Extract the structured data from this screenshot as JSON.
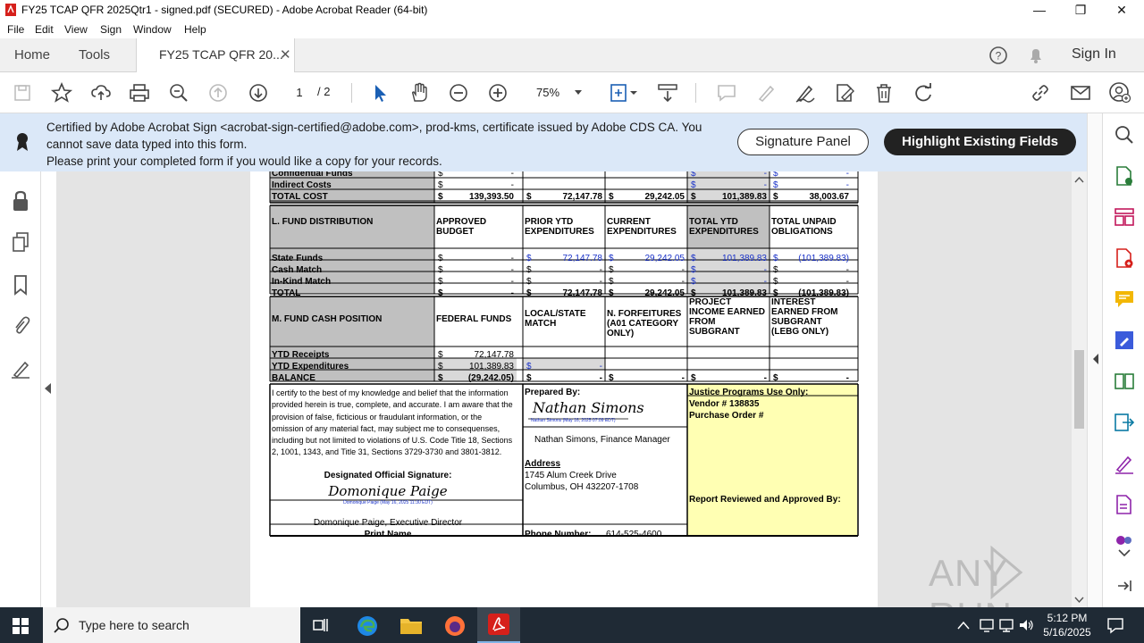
{
  "window": {
    "title": "FY25 TCAP QFR 2025Qtr1 - signed.pdf (SECURED) - Adobe Acrobat Reader (64-bit)"
  },
  "menu": [
    "File",
    "Edit",
    "View",
    "Sign",
    "Window",
    "Help"
  ],
  "tabs": {
    "home": "Home",
    "tools": "Tools",
    "document": "FY25 TCAP QFR 20...",
    "sign_in": "Sign In"
  },
  "toolbar": {
    "page_current": "1",
    "page_total": "/ 2",
    "zoom": "75%"
  },
  "notification": {
    "line1": "Certified by Adobe Acrobat Sign <acrobat-sign-certified@adobe.com>, prod-kms, certificate issued by Adobe CDS CA.  You cannot save data typed into this form.",
    "line2": "Please print your completed form if you would like a copy for your records.",
    "signature_panel": "Signature Panel",
    "highlight_fields": "Highlight Existing Fields"
  },
  "form": {
    "top_rows": [
      {
        "label": "Confidential Funds",
        "c1": "-",
        "c2": "",
        "c3": "",
        "c4": "-",
        "c5": "-"
      },
      {
        "label": "Indirect Costs",
        "c1": "-",
        "c2": "",
        "c3": "",
        "c4": "-",
        "c5": "-"
      },
      {
        "label": "TOTAL COST",
        "c1": "139,393.50",
        "c2": "72,147.78",
        "c3": "29,242.05",
        "c4": "101,389.83",
        "c5": "38,003.67"
      }
    ],
    "section_l": {
      "title": "L.  FUND DISTRIBUTION",
      "headers": [
        "APPROVED BUDGET",
        "PRIOR YTD EXPENDITURES",
        "CURRENT EXPENDITURES",
        "TOTAL YTD EXPENDITURES",
        "TOTAL UNPAID OBLIGATIONS"
      ],
      "rows": [
        {
          "label": "State Funds",
          "c1": "-",
          "c2": "72,147.78",
          "c3": "29,242.05",
          "c4": "101,389.83",
          "c5": "(101,389.83)"
        },
        {
          "label": "Cash Match",
          "c1": "-",
          "c2": "-",
          "c3": "-",
          "c4": "-",
          "c5": "-"
        },
        {
          "label": "In-Kind Match",
          "c1": "-",
          "c2": "-",
          "c3": "-",
          "c4": "-",
          "c5": "-"
        },
        {
          "label": "TOTAL",
          "c1": "-",
          "c2": "72,147.78",
          "c3": "29,242.05",
          "c4": "101,389.83",
          "c5": "(101,389.83)"
        }
      ]
    },
    "section_m": {
      "title": "M.  FUND CASH POSITION",
      "headers": [
        "FEDERAL FUNDS",
        "LOCAL/STATE MATCH",
        "N.  FORFEITURES (A01 CATEGORY ONLY)",
        "PROJECT INCOME EARNED FROM SUBGRANT",
        "INTEREST EARNED FROM SUBGRANT (LEBG ONLY)"
      ],
      "rows": [
        {
          "label": "YTD Receipts",
          "c1": "72,147.78",
          "c2": "",
          "c3": "",
          "c4": "",
          "c5": ""
        },
        {
          "label": "YTD Expenditures",
          "c1": "101,389.83",
          "c2": "-",
          "c3": "",
          "c4": "",
          "c5": ""
        },
        {
          "label": "BALANCE",
          "c1": "(29,242.05)",
          "c2": "-",
          "c3": "-",
          "c4": "-",
          "c5": "-"
        }
      ]
    },
    "dollar": "$",
    "certification": "I certify to the best of my knowledge and belief that the information provided herein is true, complete, and accurate. I am aware that the provision of false, ficticious or fraudulant information, or the omission of any material fact, may subject me to consequenses, including but not limited to violations of U.S. Code Title 18, Sections 2, 1001, 1343, and Title 31, Sections 3729-3730 and 3801-3812.",
    "designated_sig_label": "Designated Official Signature:",
    "official_signature": "Domonique Paige",
    "official_sig_stamp": "Domonique Paige (May 16, 2025 11:30 EDT)",
    "official_name": "Domonique Paige, Executive Director",
    "print_name_label": "Print Name",
    "prepared_by_label": "Prepared By:",
    "preparer_signature": "Nathan Simons",
    "preparer_sig_stamp": "Nathan Simons (May 16, 2025 07:09 EDT)",
    "preparer_name": "Nathan Simons, Finance Manager",
    "address_label": "Address",
    "address_line1": "1745 Alum Creek Drive",
    "address_line2": "Columbus, OH 432207-1708",
    "phone_label": "Phone Number:",
    "phone": "614-525-4600",
    "justice_title": "Justice Programs Use Only:",
    "vendor": "Vendor # 138835",
    "purchase_order": "Purchase Order #",
    "reviewed": "Report Reviewed and Approved By:"
  },
  "taskbar": {
    "search_placeholder": "Type here to search",
    "time": "5:12 PM",
    "date": "5/16/2025"
  },
  "watermark": "ANY RUN",
  "colors": {
    "notification_bg": "#dbe8f8",
    "acrobat_red": "#d6201b",
    "taskbar_bg": "#1f2a35",
    "form_yellow": "#ffffb3",
    "form_gray": "#c0c0c0"
  }
}
